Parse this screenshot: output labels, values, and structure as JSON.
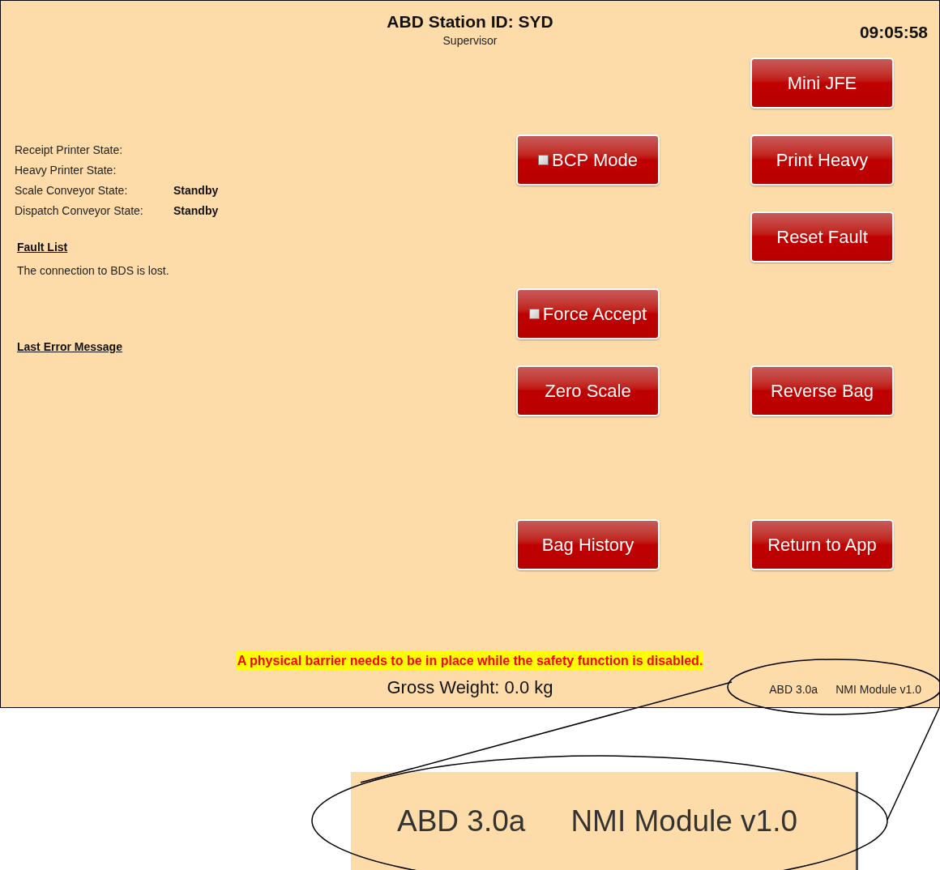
{
  "header": {
    "title": "ABD Station ID: SYD",
    "role": "Supervisor",
    "clock": "09:05:58"
  },
  "states": [
    {
      "label": "Receipt Printer State:"
    },
    {
      "label": "Heavy Printer State:"
    },
    {
      "label": "Scale Conveyor State:",
      "value": "Standby"
    },
    {
      "label": "Dispatch Conveyor State:",
      "value": "Standby"
    }
  ],
  "fault_list": {
    "heading": "Fault List",
    "items": [
      "The connection to BDS is lost."
    ]
  },
  "last_error": {
    "heading": "Last Error Message"
  },
  "button_rows": [
    {
      "cells": [
        {
          "kind": "empty"
        },
        {
          "kind": "button",
          "label": "Mini JFE"
        }
      ]
    },
    {
      "cells": [
        {
          "kind": "toggle",
          "label": "BCP Mode",
          "checked": false
        },
        {
          "kind": "button",
          "label": "Print Heavy"
        }
      ]
    },
    {
      "cells": [
        {
          "kind": "empty"
        },
        {
          "kind": "button",
          "label": "Reset Fault"
        }
      ]
    },
    {
      "cells": [
        {
          "kind": "toggle",
          "label": "Force Accept",
          "checked": false
        },
        {
          "kind": "empty"
        }
      ]
    },
    {
      "cells": [
        {
          "kind": "button",
          "label": "Zero Scale"
        },
        {
          "kind": "button",
          "label": "Reverse Bag"
        }
      ]
    },
    {
      "cells": [
        {
          "kind": "empty"
        },
        {
          "kind": "empty"
        }
      ]
    },
    {
      "cells": [
        {
          "kind": "button",
          "label": "Bag History"
        },
        {
          "kind": "button",
          "label": "Return to App"
        }
      ]
    }
  ],
  "warning": "A physical barrier needs to be in place while the safety function is disabled.",
  "gross_weight": "Gross Weight: 0.0 kg",
  "versions": [
    "ABD 3.0a",
    "NMI Module v1.0"
  ],
  "callout": {
    "versions": [
      "ABD 3.0a",
      "NMI Module v1.0"
    ]
  }
}
